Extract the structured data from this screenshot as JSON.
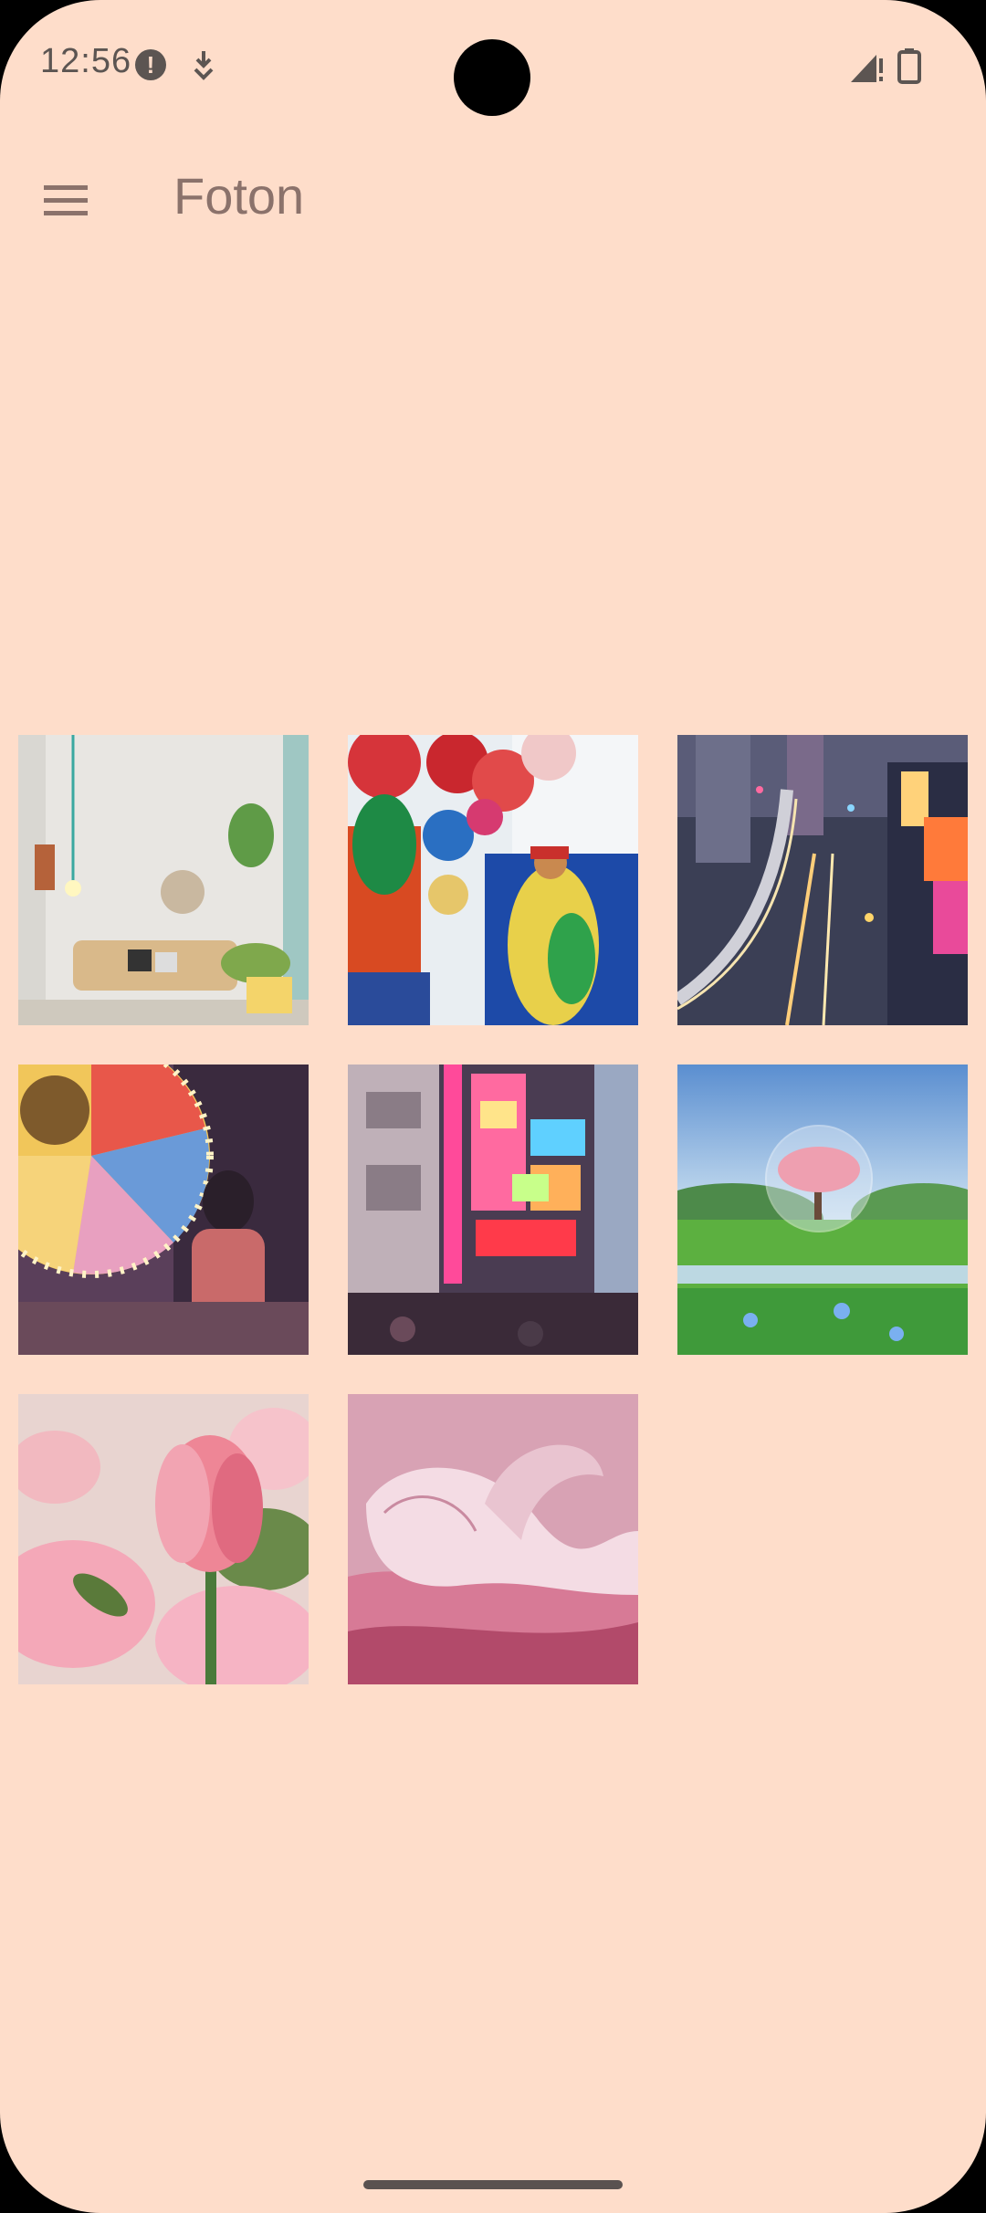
{
  "status_bar": {
    "time": "12:56",
    "icons": [
      "alert-icon",
      "download-icon",
      "signal-icon",
      "battery-icon"
    ]
  },
  "app_bar": {
    "title": "Foton",
    "menu_icon": "menu-icon"
  },
  "gallery": {
    "photos": [
      {
        "name": "living-room-photo"
      },
      {
        "name": "balloons-photo"
      },
      {
        "name": "city-night-highway-photo"
      },
      {
        "name": "carnival-wheel-photo"
      },
      {
        "name": "neon-street-photo"
      },
      {
        "name": "tree-in-bubble-landscape-photo"
      },
      {
        "name": "pink-tulip-photo"
      },
      {
        "name": "pink-abstract-shapes-photo"
      }
    ]
  },
  "colors": {
    "background": "#FEDDCA",
    "title": "#8b726b",
    "status_text": "#5c5552"
  }
}
